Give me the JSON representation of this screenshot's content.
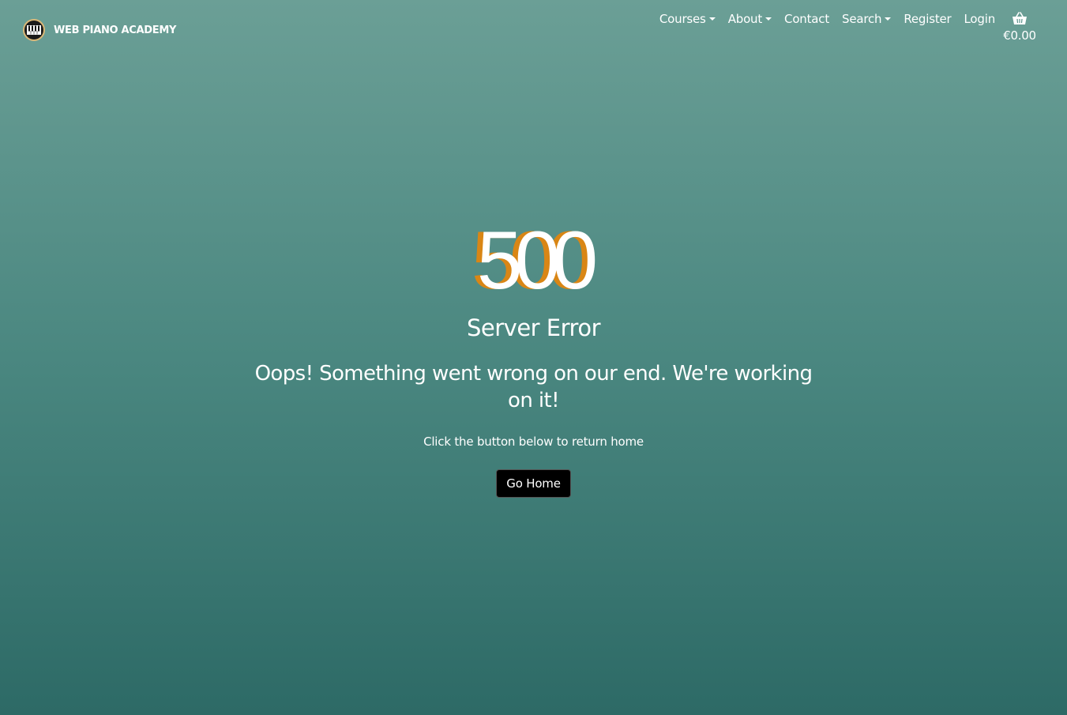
{
  "brand": {
    "name": "WEB PIANO ACADEMY",
    "logo_icon": "piano-keys-icon"
  },
  "nav": {
    "items": [
      {
        "label": "Courses",
        "dropdown": true
      },
      {
        "label": "About",
        "dropdown": true
      },
      {
        "label": "Contact",
        "dropdown": false
      },
      {
        "label": "Search",
        "dropdown": true
      },
      {
        "label": "Register",
        "dropdown": false
      },
      {
        "label": "Login",
        "dropdown": false
      }
    ]
  },
  "cart": {
    "icon": "basket-icon",
    "amount": "€0.00"
  },
  "error": {
    "code": "500",
    "title": "Server Error",
    "message": "Oops! Something went wrong on our end. We're working on it!",
    "hint": "Click the button below to return home",
    "button_label": "Go Home"
  },
  "colors": {
    "accent_orange": "#d98615",
    "background_top": "#6b9f96",
    "background_bottom": "#2d6a66",
    "button_bg": "#000000"
  }
}
